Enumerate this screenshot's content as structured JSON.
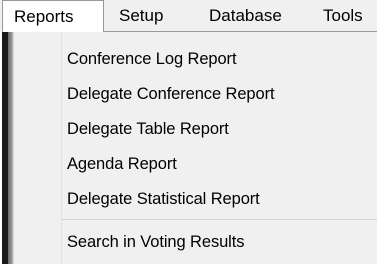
{
  "menubar": {
    "items": [
      {
        "label": "Reports",
        "active": true
      },
      {
        "label": "Setup",
        "active": false
      },
      {
        "label": "Database",
        "active": false
      },
      {
        "label": "Tools",
        "active": false
      }
    ]
  },
  "reports_menu": {
    "items": [
      {
        "label": "Conference Log Report"
      },
      {
        "label": "Delegate Conference Report"
      },
      {
        "label": "Delegate Table Report"
      },
      {
        "label": "Agenda Report"
      },
      {
        "label": "Delegate Statistical Report"
      },
      {
        "label": "Search in Voting Results"
      }
    ]
  },
  "colors": {
    "menubar_bg": "#f0f0f0",
    "menu_bg": "#f0f0f0",
    "active_tab_bg": "#ffffff",
    "text": "#000000",
    "separator": "#d4d4d4"
  }
}
